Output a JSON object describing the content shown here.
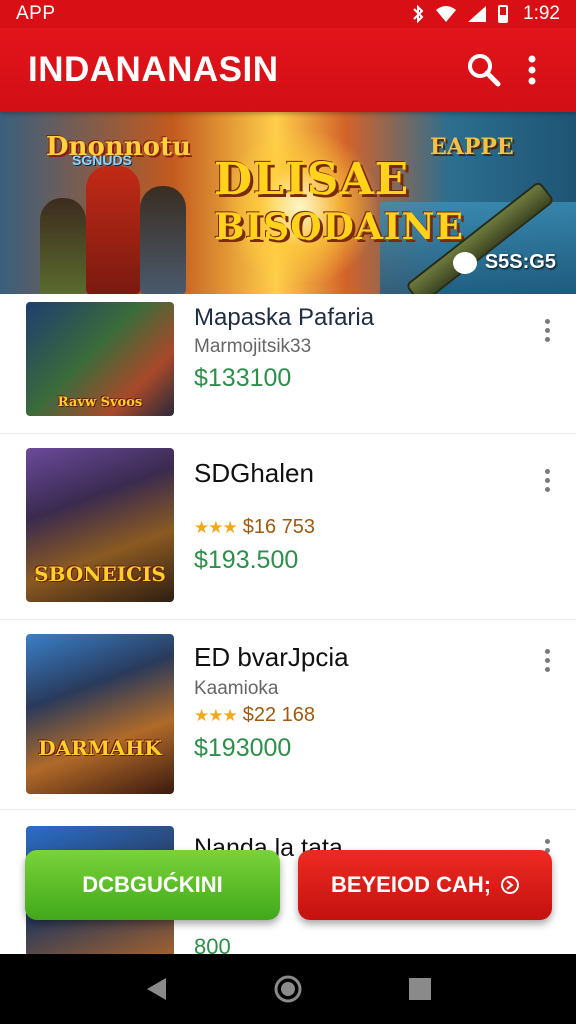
{
  "status_bar": {
    "app_label": "APP",
    "time": "1:92"
  },
  "app_bar": {
    "title": "INDANANASIN",
    "search_icon": "search-icon",
    "more_icon": "more-vert-icon"
  },
  "banner": {
    "logo_left": "Dnonnotu",
    "logo_left_sub": "SGNUDS",
    "title_line1": "DLISAE",
    "title_line2": "BISODAINE",
    "logo_right": "EAPPE",
    "badge_text": "S5S:G5"
  },
  "items": [
    {
      "thumb_text": "Ravw Svoos",
      "title": "Mapaska Pafaria",
      "subtitle": "Marmojitsik33",
      "rating": "",
      "price": "$133100"
    },
    {
      "thumb_text": "SBONEICIS",
      "title": "SDGhalen",
      "subtitle": "",
      "rating": "$16 753",
      "price": "$193.500"
    },
    {
      "thumb_text": "DARMAHK",
      "title": "ED bvarJpcia",
      "subtitle": "Kaamioka",
      "rating": "$22 168",
      "price": "$193000"
    },
    {
      "thumb_text": "",
      "title": "Nanda la tata",
      "subtitle": "",
      "rating": "",
      "price": "800"
    }
  ],
  "buttons": {
    "left": "DCBGUĆKINI",
    "right": "BEYEIOD CAH;"
  },
  "colors": {
    "primary_red": "#d81016",
    "price_green": "#2e8f4a",
    "button_green": "#41a81a"
  }
}
